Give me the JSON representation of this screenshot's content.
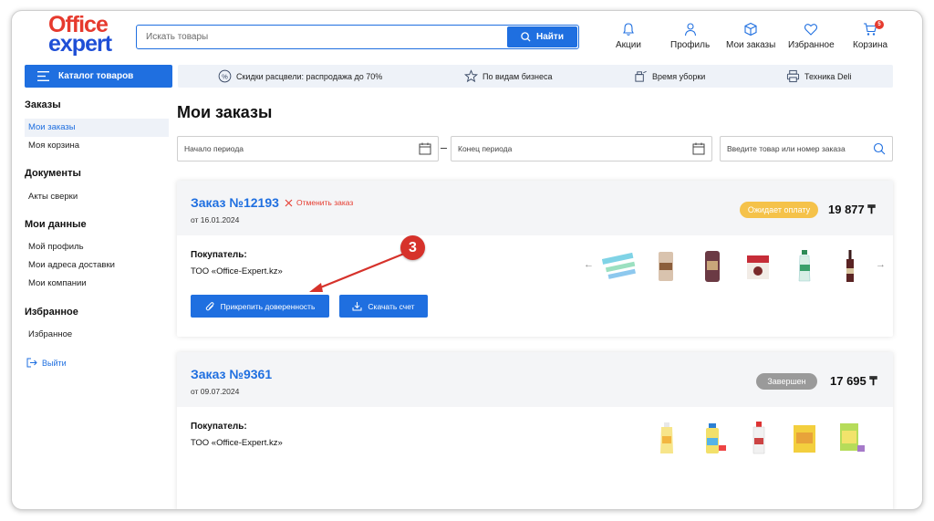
{
  "header": {
    "logo_line1": "Office",
    "logo_line2": "expert",
    "search_placeholder": "Искать товары",
    "search_button": "Найти",
    "nav": [
      {
        "label": "Акции",
        "icon": "bell-icon"
      },
      {
        "label": "Профиль",
        "icon": "user-icon"
      },
      {
        "label": "Мои заказы",
        "icon": "box-icon"
      },
      {
        "label": "Избранное",
        "icon": "heart-icon"
      },
      {
        "label": "Корзина",
        "icon": "cart-icon",
        "badge": "5"
      }
    ]
  },
  "catalog": {
    "label": "Каталог товаров",
    "promos": [
      {
        "label": "Скидки расцвели: распродажа до 70%",
        "icon": "percent-icon"
      },
      {
        "label": "По видам бизнеса",
        "icon": "star-icon"
      },
      {
        "label": "Время уборки",
        "icon": "cleaning-icon"
      },
      {
        "label": "Техника Deli",
        "icon": "printer-icon"
      }
    ]
  },
  "sidebar": {
    "sections": [
      {
        "title": "Заказы",
        "items": [
          "Мои заказы",
          "Моя корзина"
        ]
      },
      {
        "title": "Документы",
        "items": [
          "Акты сверки"
        ]
      },
      {
        "title": "Мои данные",
        "items": [
          "Мой профиль",
          "Мои адреса доставки",
          "Мои компании"
        ]
      },
      {
        "title": "Избранное",
        "items": [
          "Избранное"
        ]
      }
    ],
    "active_item": "Мои заказы",
    "logout": "Выйти"
  },
  "main": {
    "title": "Мои заказы",
    "filters": {
      "start_placeholder": "Начало периода",
      "end_placeholder": "Конец периода",
      "search_placeholder": "Введите товар или номер заказа"
    },
    "orders": [
      {
        "number": "Заказ №12193",
        "date": "от 16.01.2024",
        "cancel_label": "Отменить заказ",
        "status": "Ожидает оплату",
        "status_color": "#f5c24a",
        "total": "19 877 ₸",
        "buyer_label": "Покупатель:",
        "buyer_name": "ТОО «Office-Expert.kz»",
        "attach_button": "Прикрепить доверенность",
        "download_button": "Скачать счет"
      },
      {
        "number": "Заказ №9361",
        "date": "от 09.07.2024",
        "status": "Завершен",
        "status_color": "#9a9a9a",
        "total": "17 695 ₸",
        "buyer_label": "Покупатель:",
        "buyer_name": "ТОО «Office-Expert.kz»"
      }
    ],
    "step_marker": "3"
  },
  "colors": {
    "accent": "#1f6fe0",
    "brand_red": "#e63a2e",
    "marker_red": "#d6322b"
  }
}
